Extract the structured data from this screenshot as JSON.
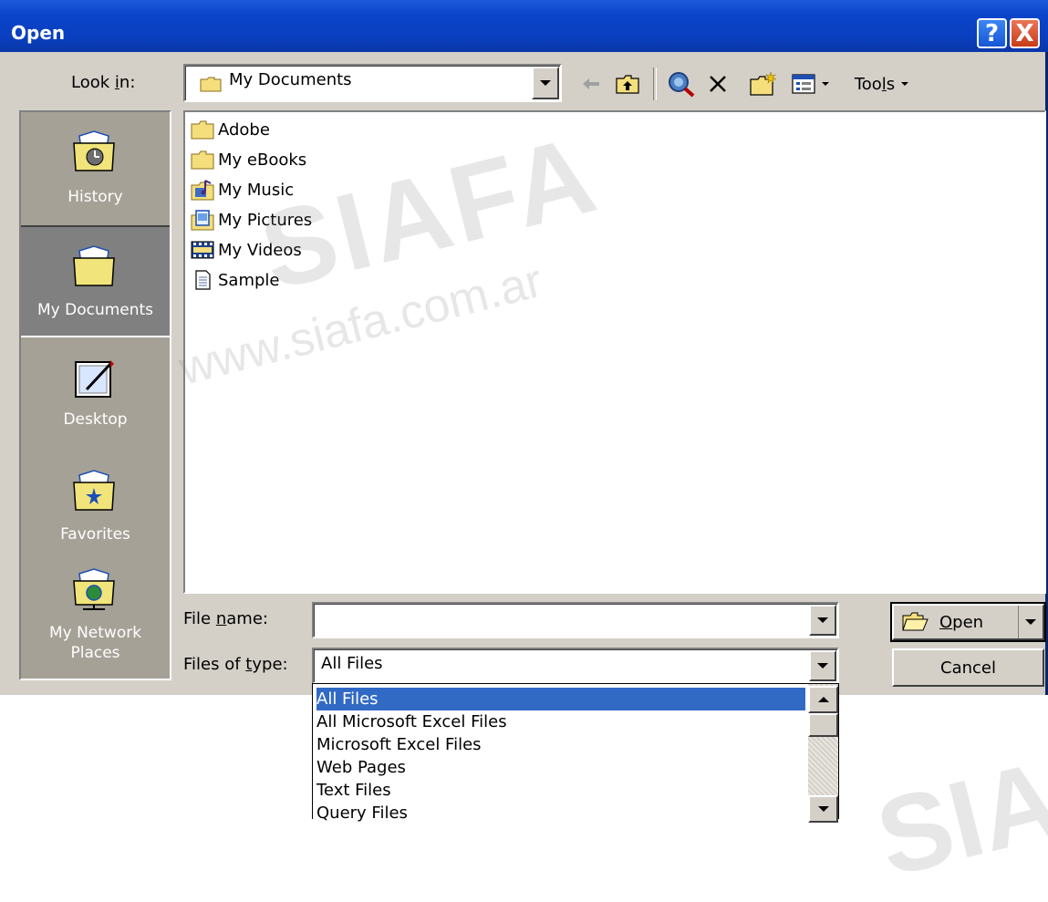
{
  "window": {
    "title": "Open",
    "help": "?",
    "close": "X"
  },
  "lookin": {
    "label_pre": "Look ",
    "label_u": "i",
    "label_post": "n:",
    "value": "My Documents"
  },
  "toolbar": {
    "tools_pre": "Too",
    "tools_u": "l",
    "tools_post": "s"
  },
  "places": [
    {
      "label": "History",
      "icon": "history-icon"
    },
    {
      "label": "My Documents",
      "icon": "my-documents-icon",
      "selected": true
    },
    {
      "label": "Desktop",
      "icon": "desktop-icon"
    },
    {
      "label": "Favorites",
      "icon": "favorites-icon"
    },
    {
      "label_line1": "My Network",
      "label_line2": "Places",
      "icon": "network-places-icon"
    }
  ],
  "files": [
    {
      "name": "Adobe",
      "icon": "folder-icon"
    },
    {
      "name": "My eBooks",
      "icon": "folder-icon"
    },
    {
      "name": "My Music",
      "icon": "music-folder-icon"
    },
    {
      "name": "My Pictures",
      "icon": "pictures-folder-icon"
    },
    {
      "name": "My Videos",
      "icon": "videos-folder-icon"
    },
    {
      "name": "Sample",
      "icon": "document-icon"
    }
  ],
  "filename": {
    "label_pre": "File ",
    "label_u": "n",
    "label_post": "ame:",
    "value": ""
  },
  "filetype": {
    "label_pre": "Files of ",
    "label_u": "t",
    "label_post": "ype:",
    "value": "All Files"
  },
  "buttons": {
    "open_u": "O",
    "open_post": "pen",
    "cancel": "Cancel"
  },
  "dropdown_options": [
    "All Files",
    "All Microsoft Excel Files",
    "Microsoft Excel Files",
    "Web Pages",
    "Text Files",
    "Query Files"
  ],
  "watermark": {
    "brand": "SIAFA",
    "url": "www.siafa.com.ar"
  }
}
